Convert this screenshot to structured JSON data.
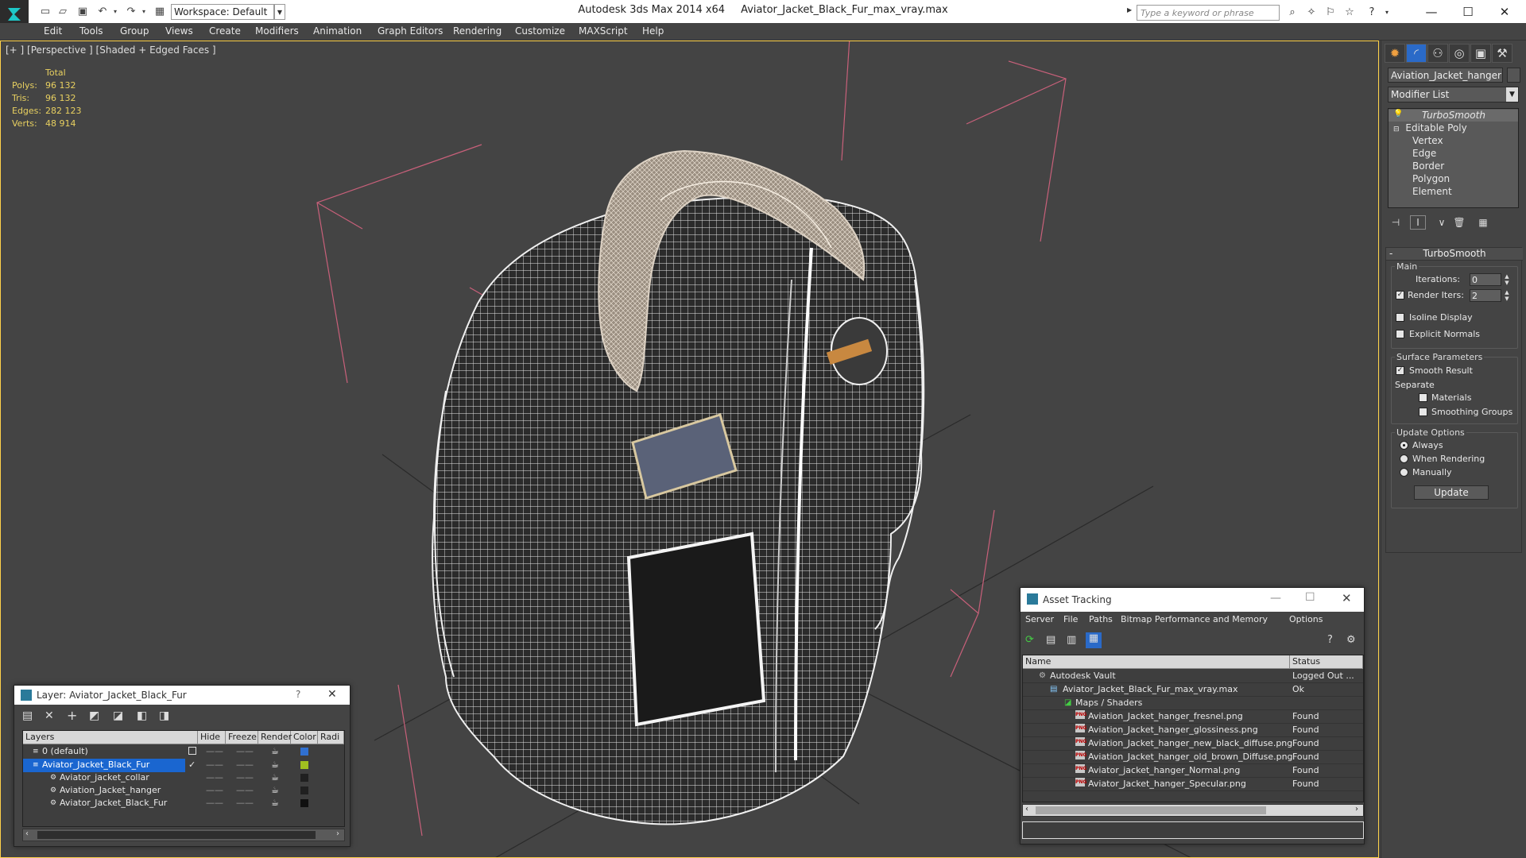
{
  "titlebar": {
    "workspace": "Workspace: Default",
    "app_name": "Autodesk 3ds Max  2014 x64",
    "file_name": "Aviator_Jacket_Black_Fur_max_vray.max",
    "search_placeholder": "Type a keyword or phrase"
  },
  "menu": [
    "Edit",
    "Tools",
    "Group",
    "Views",
    "Create",
    "Modifiers",
    "Animation",
    "Graph Editors",
    "Rendering",
    "Customize",
    "MAXScript",
    "Help"
  ],
  "viewport": {
    "label": "[+ ] [Perspective ] [Shaded + Edged Faces ]",
    "stats_header": "Total",
    "stats": [
      {
        "label": "Polys:",
        "value": "96 132"
      },
      {
        "label": "Tris:",
        "value": "96 132"
      },
      {
        "label": "Edges:",
        "value": "282 123"
      },
      {
        "label": "Verts:",
        "value": "48 914"
      }
    ]
  },
  "cmdpanel": {
    "object_name": "Aviation_Jacket_hanger",
    "modifier_list": "Modifier List",
    "stack": {
      "turbosmooth": "TurboSmooth",
      "editable_poly": "Editable Poly",
      "subobjects": [
        "Vertex",
        "Edge",
        "Border",
        "Polygon",
        "Element"
      ]
    },
    "rollout": {
      "title": "TurboSmooth",
      "main": "Main",
      "iterations_label": "Iterations:",
      "iterations_value": "0",
      "render_iters_label": "Render Iters:",
      "render_iters_value": "2",
      "isoline": "Isoline Display",
      "explicit_normals": "Explicit Normals",
      "surface_params": "Surface Parameters",
      "smooth_result": "Smooth Result",
      "separate": "Separate",
      "materials": "Materials",
      "smoothing_groups": "Smoothing Groups",
      "update_options": "Update Options",
      "always": "Always",
      "when_rendering": "When Rendering",
      "manually": "Manually",
      "update_btn": "Update"
    }
  },
  "layer_window": {
    "title": "Layer: Aviator_Jacket_Black_Fur",
    "help": "?",
    "columns": [
      "Layers",
      "Hide",
      "Freeze",
      "Render",
      "Color",
      "Radi"
    ],
    "rows": [
      {
        "name": "0 (default)",
        "color": "#3070d0"
      },
      {
        "name": "Aviator_Jacket_Black_Fur",
        "color": "#a0c020"
      },
      {
        "name": "Aviator_jacket_collar",
        "color": "#202020"
      },
      {
        "name": "Aviation_Jacket_hanger",
        "color": "#202020"
      },
      {
        "name": "Aviator_Jacket_Black_Fur",
        "color": "#101010"
      }
    ]
  },
  "asset_window": {
    "title": "Asset Tracking",
    "menu": [
      "Server",
      "File",
      "Paths",
      "Bitmap Performance and Memory",
      "Options"
    ],
    "columns": [
      "Name",
      "Status"
    ],
    "rows": [
      {
        "name": "Autodesk Vault",
        "status": "Logged Out ...",
        "indent": 0,
        "kind": "vault"
      },
      {
        "name": "Aviator_Jacket_Black_Fur_max_vray.max",
        "status": "Ok",
        "indent": 1,
        "kind": "max"
      },
      {
        "name": "Maps / Shaders",
        "status": "",
        "indent": 2,
        "kind": "maps"
      },
      {
        "name": "Aviation_Jacket_hanger_fresnel.png",
        "status": "Found",
        "indent": 3,
        "kind": "png"
      },
      {
        "name": "Aviation_Jacket_hanger_glossiness.png",
        "status": "Found",
        "indent": 3,
        "kind": "png"
      },
      {
        "name": "Aviation_Jacket_hanger_new_black_diffuse.png",
        "status": "Found",
        "indent": 3,
        "kind": "png"
      },
      {
        "name": "Aviation_Jacket_hanger_old_brown_Diffuse.png",
        "status": "Found",
        "indent": 3,
        "kind": "png"
      },
      {
        "name": "Aviator_jacket_hanger_Normal.png",
        "status": "Found",
        "indent": 3,
        "kind": "png"
      },
      {
        "name": "Aviator_Jacket_hanger_Specular.png",
        "status": "Found",
        "indent": 3,
        "kind": "png"
      }
    ]
  }
}
